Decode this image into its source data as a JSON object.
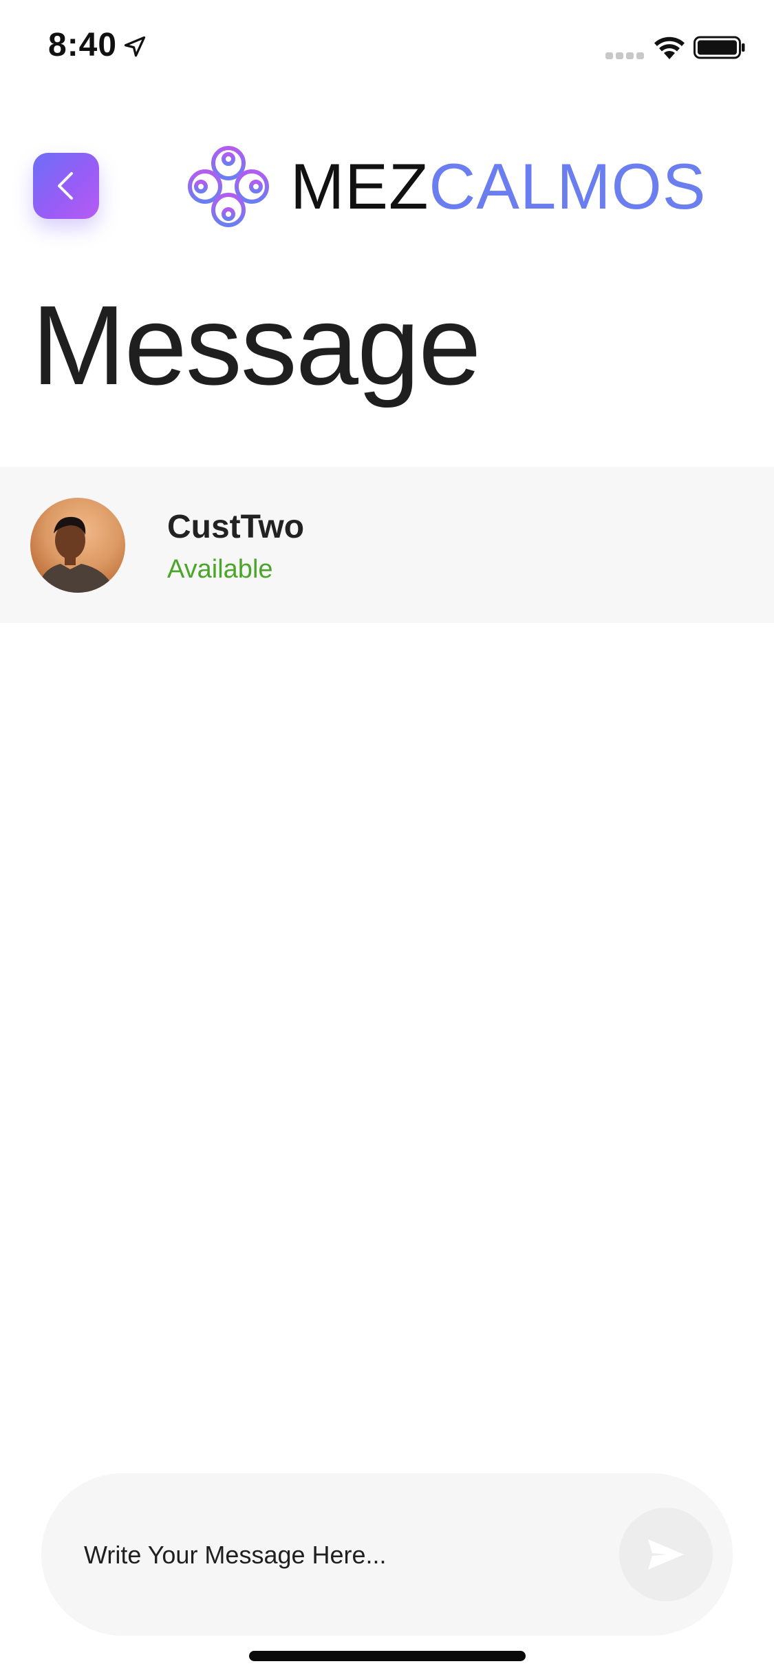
{
  "status_bar": {
    "time": "8:40",
    "location_icon": "location-arrow-icon",
    "signal_icon": "cellular-signal-icon",
    "wifi_icon": "wifi-icon",
    "battery_icon": "battery-icon"
  },
  "header": {
    "back_icon": "chevron-left-icon",
    "logo": {
      "part1": "MEZ",
      "part2": "CALMOS"
    },
    "title": "Message"
  },
  "contact": {
    "name": "CustTwo",
    "status": "Available"
  },
  "composer": {
    "placeholder": "Write Your Message Here...",
    "send_icon": "send-icon"
  },
  "colors": {
    "accent_start": "#6c6ef7",
    "accent_end": "#b75cf2",
    "logo_blue": "#6b7ef0",
    "status_green": "#4aa52a",
    "row_background": "#f7f7f7"
  }
}
